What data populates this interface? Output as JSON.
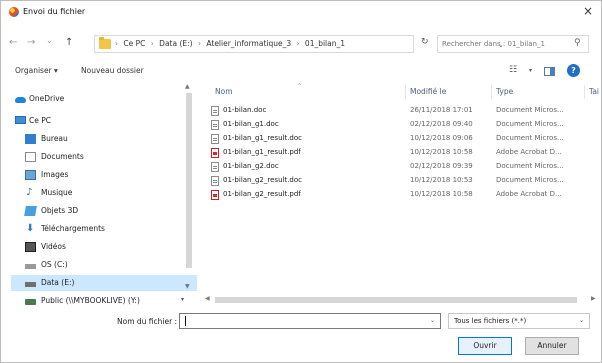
{
  "window": {
    "title": "Envoi du fichier",
    "close_glyph": "×"
  },
  "nav": {
    "back_glyph": "←",
    "forward_glyph": "→",
    "recent_glyph": "⌄",
    "up_glyph": "↑",
    "breadcrumb_sep": "›",
    "breadcrumb": [
      "Ce PC",
      "Data (E:)",
      "Atelier_informatique_3",
      "01_bilan_1"
    ],
    "address_dropdown_glyph": "⌄",
    "refresh_glyph": "↻",
    "search_placeholder": "Rechercher dans : 01_bilan_1",
    "search_glyph": "⚲"
  },
  "toolbar": {
    "organize_label": "Organiser ▾",
    "new_folder_label": "Nouveau dossier",
    "view_glyph": "☷",
    "view_dd_glyph": "▾",
    "help_glyph": "?"
  },
  "sidebar": {
    "scroll_up_glyph": "▲",
    "scroll_down_glyph": "▼",
    "items": [
      {
        "label": "OneDrive",
        "icon": "onedrive-icon"
      },
      {
        "label": "Ce PC",
        "icon": "pc-icon"
      },
      {
        "label": "Bureau",
        "icon": "desktop-icon"
      },
      {
        "label": "Documents",
        "icon": "documents-icon"
      },
      {
        "label": "Images",
        "icon": "images-icon"
      },
      {
        "label": "Musique",
        "icon": "music-icon",
        "glyph": "♪"
      },
      {
        "label": "Objets 3D",
        "icon": "objects-3d-icon"
      },
      {
        "label": "Téléchargements",
        "icon": "downloads-icon",
        "glyph": "⬇"
      },
      {
        "label": "Vidéos",
        "icon": "videos-icon"
      },
      {
        "label": "OS (C:)",
        "icon": "drive-icon"
      },
      {
        "label": "Data (E:)",
        "icon": "drive-icon"
      },
      {
        "label": "Public (\\\\MYBOOKLIVE) (Y:)",
        "icon": "network-drive-icon",
        "expander": "▾"
      }
    ]
  },
  "filelist": {
    "columns": [
      "Nom",
      "Modifié le",
      "Type",
      "Tai"
    ],
    "sort_glyph": "^",
    "rows": [
      {
        "name": "01-bilan.doc",
        "modified": "26/11/2018 17:01",
        "type": "Document Micros...",
        "kind": "doc"
      },
      {
        "name": "01-bilan_g1.doc",
        "modified": "02/12/2018 09:40",
        "type": "Document Micros...",
        "kind": "doc"
      },
      {
        "name": "01-bilan_g1_result.doc",
        "modified": "10/12/2018 09:06",
        "type": "Document Micros...",
        "kind": "doc"
      },
      {
        "name": "01-bilan_g1_result.pdf",
        "modified": "10/12/2018 10:58",
        "type": "Adobe Acrobat D...",
        "kind": "pdf"
      },
      {
        "name": "01-bilan_g2.doc",
        "modified": "02/12/2018 09:39",
        "type": "Document Micros...",
        "kind": "doc"
      },
      {
        "name": "01-bilan_g2_result.doc",
        "modified": "10/12/2018 10:53",
        "type": "Document Micros...",
        "kind": "doc"
      },
      {
        "name": "01-bilan_g2_result.pdf",
        "modified": "10/12/2018 10:58",
        "type": "Adobe Acrobat D...",
        "kind": "pdf"
      }
    ],
    "hscroll_left_glyph": "◀",
    "hscroll_right_glyph": "▶"
  },
  "footer": {
    "filename_label": "Nom du fichier :",
    "filename_value": "",
    "filename_dd_glyph": "⌄",
    "filter_value": "Tous les fichiers (*.*)",
    "filter_dd_glyph": "⌄",
    "open_label": "Ouvrir",
    "cancel_label": "Annuler"
  },
  "colors": {
    "accent": "#0078d7",
    "selection": "#cce8ff",
    "pdf_red": "#d42a2a"
  }
}
